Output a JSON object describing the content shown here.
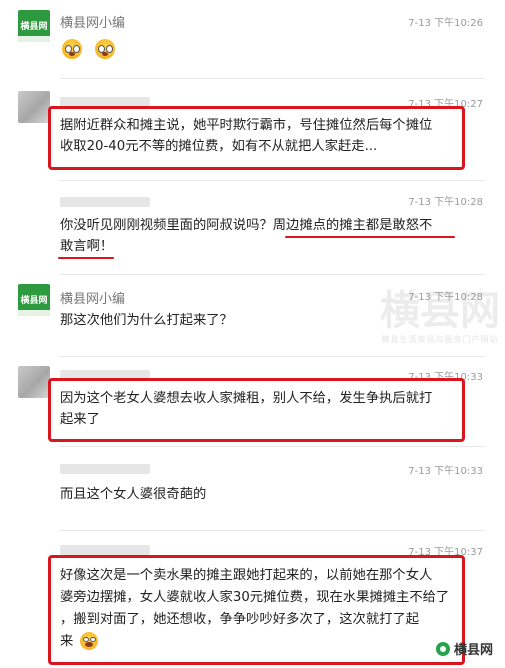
{
  "messages": [
    {
      "name": "横县网小编",
      "time": "7-13 下午10:26"
    },
    {
      "name": "",
      "time": "7-13 下午10:27",
      "lines": [
        "据附近群众和摊主说，她平时欺行霸市，号住摊位然后每个摊位",
        "收取20-40元不等的摊位费，如有不从就把人家赶走..."
      ]
    },
    {
      "name": "",
      "time": "7-13 下午10:28",
      "lines": [
        "你没听见刚刚视频里面的阿叔说吗？周边摊点的摊主都是敢怒不",
        "敢言啊！"
      ]
    },
    {
      "name": "横县网小编",
      "time": "7-13 下午10:28",
      "lines": [
        "那这次他们为什么打起来了？"
      ]
    },
    {
      "name": "",
      "time": "7-13 下午10:33",
      "lines": [
        "因为这个老女人婆想去收人家摊租，别人不给，发生争执后就打",
        "起来了"
      ]
    },
    {
      "name": "",
      "time": "7-13 下午10:33",
      "lines": [
        "而且这个女人婆很奇葩的"
      ]
    },
    {
      "name": "",
      "time": "7-13 下午10:37",
      "lines": [
        "好像这次是一个卖水果的摊主跟她打起来的，以前她在那个女人",
        "婆旁边摆摊，女人婆就收人家30元摊位费，现在水果摊摊主不给了",
        "，搬到对面了，她还想收，争争吵吵好多次了，这次就打了起",
        "来"
      ]
    }
  ],
  "avatar_label": "横县网",
  "watermark": {
    "big": "横县网",
    "small": "横县生活资讯与服务门户网站"
  },
  "footer_logo": "横县网",
  "icons": {
    "shock_emoji": "screaming-face-icon",
    "laugh_emoji": "laughing-crying-face-icon"
  },
  "colors": {
    "highlight": "#d9151d",
    "brand_green": "#2e9a3f"
  }
}
